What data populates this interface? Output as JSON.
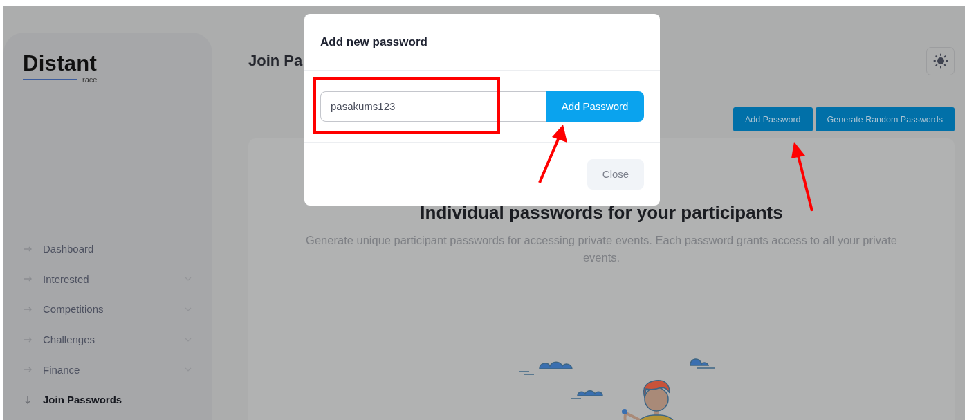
{
  "sidebar": {
    "logo": {
      "title": "Distant",
      "subtitle": "race"
    },
    "items": [
      {
        "label": "Dashboard",
        "selected": false,
        "expandable": false
      },
      {
        "label": "Interested",
        "selected": false,
        "expandable": true
      },
      {
        "label": "Competitions",
        "selected": false,
        "expandable": true
      },
      {
        "label": "Challenges",
        "selected": false,
        "expandable": true
      },
      {
        "label": "Finance",
        "selected": false,
        "expandable": true
      },
      {
        "label": "Join Passwords",
        "selected": true,
        "expandable": false
      }
    ]
  },
  "header": {
    "title": "Join Pa"
  },
  "toolbar": {
    "buttons": [
      "Add Password",
      "Generate Random Passwords"
    ]
  },
  "card": {
    "title": "Individual passwords for your participants",
    "description": "Generate unique participant passwords for accessing private events. Each password grants access to all your private events."
  },
  "modal": {
    "title": "Add new password",
    "input": {
      "value": "pasakums123"
    },
    "submit": "Add Password",
    "close": "Close"
  }
}
